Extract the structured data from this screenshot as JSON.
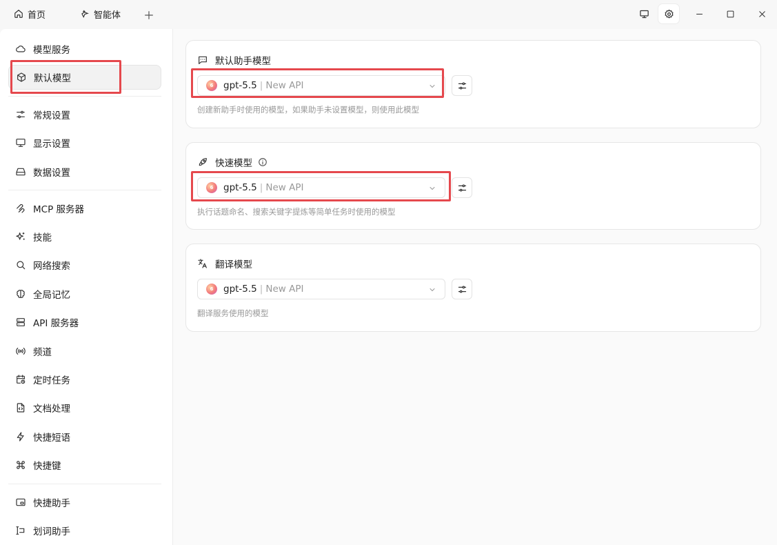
{
  "titlebar": {
    "tabs": [
      {
        "label": "首页",
        "icon": "home-icon"
      },
      {
        "label": "智能体",
        "icon": "sparkle-agent-icon"
      }
    ],
    "controls": [
      "monitor-icon",
      "settings-icon",
      "minimize-icon",
      "maximize-icon",
      "close-icon"
    ]
  },
  "sidebar": {
    "items": [
      {
        "label": "模型服务",
        "icon": "cloud-icon"
      },
      {
        "label": "默认模型",
        "icon": "cube-icon",
        "active": true
      },
      {
        "label": "常规设置",
        "icon": "sliders-icon"
      },
      {
        "label": "显示设置",
        "icon": "display-icon"
      },
      {
        "label": "数据设置",
        "icon": "hard-drive-icon"
      },
      {
        "label": "MCP 服务器",
        "icon": "mcp-icon"
      },
      {
        "label": "技能",
        "icon": "sparkles-icon"
      },
      {
        "label": "网络搜索",
        "icon": "search-icon"
      },
      {
        "label": "全局记忆",
        "icon": "brain-icon"
      },
      {
        "label": "API 服务器",
        "icon": "server-icon"
      },
      {
        "label": "频道",
        "icon": "radio-icon"
      },
      {
        "label": "定时任务",
        "icon": "calendar-clock-icon"
      },
      {
        "label": "文档处理",
        "icon": "file-code-icon"
      },
      {
        "label": "快捷短语",
        "icon": "zap-icon"
      },
      {
        "label": "快捷键",
        "icon": "command-icon"
      },
      {
        "label": "快捷助手",
        "icon": "app-window-icon"
      },
      {
        "label": "划词助手",
        "icon": "text-select-icon"
      }
    ]
  },
  "main": {
    "cards": [
      {
        "title": "默认助手模型",
        "icon": "chat-bubble-icon",
        "model": "gpt-5.5",
        "separator": "|",
        "provider": "New API",
        "hint": "创建新助手时使用的模型，如果助手未设置模型，则使用此模型"
      },
      {
        "title": "快速模型",
        "icon": "rocket-icon",
        "model": "gpt-5.5",
        "separator": "|",
        "provider": "New API",
        "hint": "执行话题命名、搜索关键字提炼等简单任务时使用的模型"
      },
      {
        "title": "翻译模型",
        "icon": "translate-icon",
        "model": "gpt-5.5",
        "separator": "|",
        "provider": "New API",
        "hint": "翻译服务使用的模型"
      }
    ]
  },
  "highlight_color": "#e5484d"
}
